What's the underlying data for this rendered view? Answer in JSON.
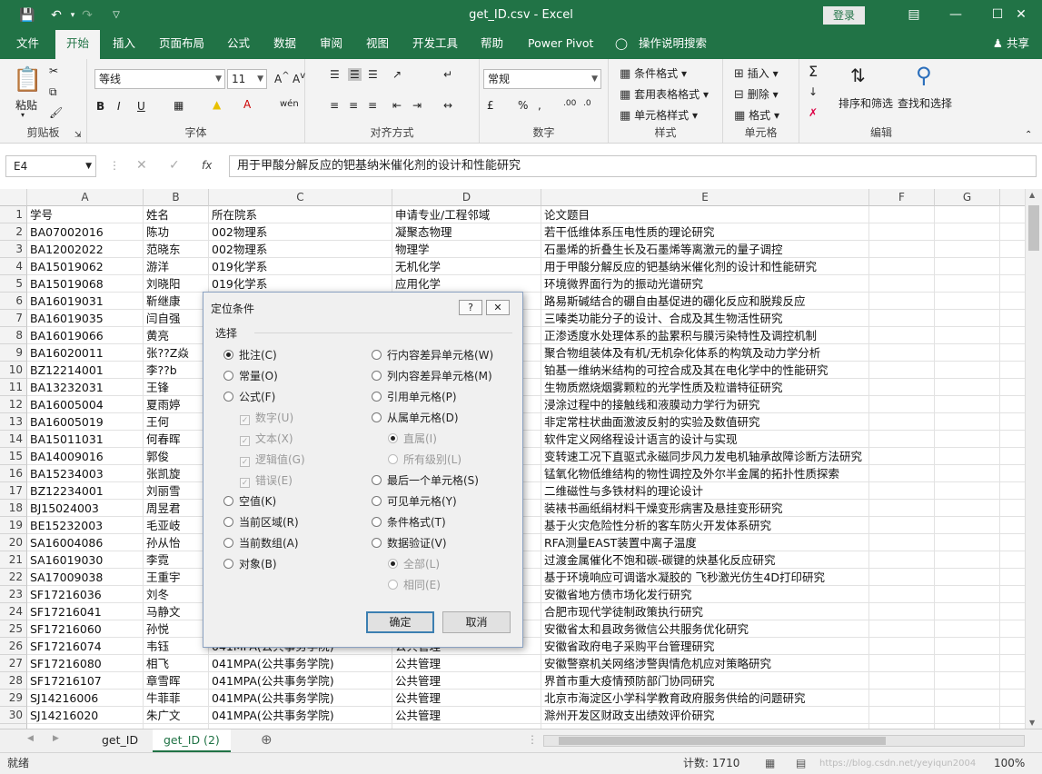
{
  "titlebar": {
    "title": "get_ID.csv  -  Excel",
    "login": "登录"
  },
  "tabs": [
    "文件",
    "开始",
    "插入",
    "页面布局",
    "公式",
    "数据",
    "审阅",
    "视图",
    "开发工具",
    "帮助",
    "Power Pivot"
  ],
  "tell_me": "操作说明搜索",
  "share": "共享",
  "ribbon": {
    "clipboard": {
      "label": "剪贴板",
      "paste": "粘贴"
    },
    "font": {
      "label": "字体",
      "name": "等线",
      "size": "11"
    },
    "alignment": {
      "label": "对齐方式"
    },
    "number": {
      "label": "数字",
      "format": "常规"
    },
    "styles": {
      "label": "样式",
      "cond": "条件格式",
      "table": "套用表格格式",
      "cell": "单元格样式"
    },
    "cells": {
      "label": "单元格",
      "insert": "插入",
      "delete": "删除",
      "format": "格式"
    },
    "editing": {
      "label": "编辑",
      "sort": "排序和筛选",
      "find": "查找和选择"
    }
  },
  "formula_bar": {
    "name_box": "E4",
    "fx": "fx",
    "content": "用于甲酸分解反应的钯基纳米催化剂的设计和性能研究"
  },
  "columns": [
    "A",
    "B",
    "C",
    "D",
    "E",
    "F",
    "G"
  ],
  "rows": [
    {
      "n": "1",
      "a": "学号",
      "b": "姓名",
      "c": "所在院系",
      "d": "申请专业/工程邻域",
      "e": "论文题目"
    },
    {
      "n": "2",
      "a": "BA07002016",
      "b": "陈功",
      "c": "002物理系",
      "d": "凝聚态物理",
      "e": "若干低维体系压电性质的理论研究"
    },
    {
      "n": "3",
      "a": "BA12002022",
      "b": "范晓东",
      "c": "002物理系",
      "d": "物理学",
      "e": "石墨烯的折叠生长及石墨烯等离激元的量子调控"
    },
    {
      "n": "4",
      "a": "BA15019062",
      "b": "游洋",
      "c": "019化学系",
      "d": "无机化学",
      "e": "用于甲酸分解反应的钯基纳米催化剂的设计和性能研究"
    },
    {
      "n": "5",
      "a": "BA15019068",
      "b": "刘晓阳",
      "c": "019化学系",
      "d": "应用化学",
      "e": "环境微界面行为的振动光谱研究"
    },
    {
      "n": "6",
      "a": "BA16019031",
      "b": "靳继康",
      "c": "",
      "d": "",
      "e": "路易斯碱结合的硼自由基促进的硼化反应和脱羧反应"
    },
    {
      "n": "7",
      "a": "BA16019035",
      "b": "闫自强",
      "c": "",
      "d": "",
      "e": "三嗪类功能分子的设计、合成及其生物活性研究"
    },
    {
      "n": "8",
      "a": "BA16019066",
      "b": "黄亮",
      "c": "",
      "d": "",
      "e": "正渗透度水处理体系的盐累积与膜污染特性及调控机制"
    },
    {
      "n": "9",
      "a": "BA16020011",
      "b": "张??Z焱",
      "c": "",
      "d": "",
      "e": "聚合物组装体及有机/无机杂化体系的构筑及动力学分析"
    },
    {
      "n": "10",
      "a": "BZ12214001",
      "b": "李??b",
      "c": "",
      "d": "",
      "e": "铂基一维纳米结构的可控合成及其在电化学中的性能研究"
    },
    {
      "n": "11",
      "a": "BA13232031",
      "b": "王锋",
      "c": "",
      "d": "",
      "e": "生物质燃烧烟雾颗粒的光学性质及粒谱特征研究"
    },
    {
      "n": "12",
      "a": "BA16005004",
      "b": "夏雨婷",
      "c": "",
      "d": "",
      "e": "浸涂过程中的接触线和液膜动力学行为研究"
    },
    {
      "n": "13",
      "a": "BA16005019",
      "b": "王何",
      "c": "",
      "d": "",
      "e": "非定常柱状曲面激波反射的实验及数值研究"
    },
    {
      "n": "14",
      "a": "BA15011031",
      "b": "何春晖",
      "c": "",
      "d": "",
      "e": "软件定义网络程设计语言的设计与实现"
    },
    {
      "n": "15",
      "a": "BA14009016",
      "b": "郭俊",
      "c": "",
      "d": "",
      "e": "变转速工况下直驱式永磁同步风力发电机轴承故障诊断方法研究"
    },
    {
      "n": "16",
      "a": "BA15234003",
      "b": "张凯旋",
      "c": "",
      "d": "",
      "e": "锰氧化物低维结构的物性调控及外尔半金属的拓扑性质探索"
    },
    {
      "n": "17",
      "a": "BZ12234001",
      "b": "刘丽雪",
      "c": "",
      "d": "",
      "e": "二维磁性与多铁材料的理论设计"
    },
    {
      "n": "18",
      "a": "BJ15024003",
      "b": "周昱君",
      "c": "",
      "d": "",
      "e": "装裱书画纸绢材料干燥变形病害及悬挂变形研究"
    },
    {
      "n": "19",
      "a": "BE15232003",
      "b": "毛亚岐",
      "c": "",
      "d": "",
      "e": "基于火灾危险性分析的客车防火开发体系研究"
    },
    {
      "n": "20",
      "a": "SA16004086",
      "b": "孙从怡",
      "c": "",
      "d": "",
      "e": "RFA测量EAST装置中离子温度"
    },
    {
      "n": "21",
      "a": "SA16019030",
      "b": "李霓",
      "c": "",
      "d": "",
      "e": "过渡金属催化不饱和碳-碳键的炔基化反应研究"
    },
    {
      "n": "22",
      "a": "SA17009038",
      "b": "王重宇",
      "c": "",
      "d": "",
      "e": "基于环境响应可调谐水凝胶的 飞秒激光仿生4D打印研究"
    },
    {
      "n": "23",
      "a": "SF17216036",
      "b": "刘冬",
      "c": "",
      "d": "",
      "e": "安徽省地方债市场化发行研究"
    },
    {
      "n": "24",
      "a": "SF17216041",
      "b": "马静文",
      "c": "",
      "d": "",
      "e": "合肥市现代学徒制政策执行研究"
    },
    {
      "n": "25",
      "a": "SF17216060",
      "b": "孙悦",
      "c": "",
      "d": "",
      "e": "安徽省太和县政务微信公共服务优化研究"
    },
    {
      "n": "26",
      "a": "SF17216074",
      "b": "韦钰",
      "c": "041MPA(公共事务学院)",
      "d": "公共管理",
      "e": "安徽省政府电子采购平台管理研究"
    },
    {
      "n": "27",
      "a": "SF17216080",
      "b": "相飞",
      "c": "041MPA(公共事务学院)",
      "d": "公共管理",
      "e": "安徽警察机关网络涉警舆情危机应对策略研究"
    },
    {
      "n": "28",
      "a": "SF17216107",
      "b": "章雪晖",
      "c": "041MPA(公共事务学院)",
      "d": "公共管理",
      "e": "界首市重大疫情预防部门协同研究"
    },
    {
      "n": "29",
      "a": "SJ14216006",
      "b": "牛菲菲",
      "c": "041MPA(公共事务学院)",
      "d": "公共管理",
      "e": "北京市海淀区小学科学教育政府服务供给的问题研究"
    },
    {
      "n": "30",
      "a": "SJ14216020",
      "b": "朱广文",
      "c": "041MPA(公共事务学院)",
      "d": "公共管理",
      "e": "滁州开发区财政支出绩效评价研究"
    }
  ],
  "dialog": {
    "title": "定位条件",
    "help": "?",
    "close": "✕",
    "section": "选择",
    "left": [
      {
        "label": "批注(C)",
        "checked": true
      },
      {
        "label": "常量(O)",
        "checked": false
      },
      {
        "label": "公式(F)",
        "checked": false
      }
    ],
    "formula_subs": [
      "数字(U)",
      "文本(X)",
      "逻辑值(G)",
      "错误(E)"
    ],
    "left2": [
      {
        "label": "空值(K)"
      },
      {
        "label": "当前区域(R)"
      },
      {
        "label": "当前数组(A)"
      },
      {
        "label": "对象(B)"
      }
    ],
    "right": [
      {
        "label": "行内容差异单元格(W)"
      },
      {
        "label": "列内容差异单元格(M)"
      },
      {
        "label": "引用单元格(P)"
      },
      {
        "label": "从属单元格(D)"
      }
    ],
    "dep_subs": [
      {
        "label": "直属(I)",
        "checked": true
      },
      {
        "label": "所有级别(L)",
        "checked": false
      }
    ],
    "right2": [
      {
        "label": "最后一个单元格(S)"
      },
      {
        "label": "可见单元格(Y)"
      },
      {
        "label": "条件格式(T)"
      },
      {
        "label": "数据验证(V)"
      }
    ],
    "val_subs": [
      {
        "label": "全部(L)",
        "checked": true
      },
      {
        "label": "相同(E)",
        "checked": false
      }
    ],
    "ok": "确定",
    "cancel": "取消"
  },
  "sheets": [
    "get_ID",
    "get_ID (2)"
  ],
  "status": {
    "ready": "就绪",
    "count": "计数: 1710",
    "zoom": "100%",
    "watermark": "https://blog.csdn.net/yeyiqun2004"
  },
  "colors": {
    "excel_green": "#217346"
  }
}
